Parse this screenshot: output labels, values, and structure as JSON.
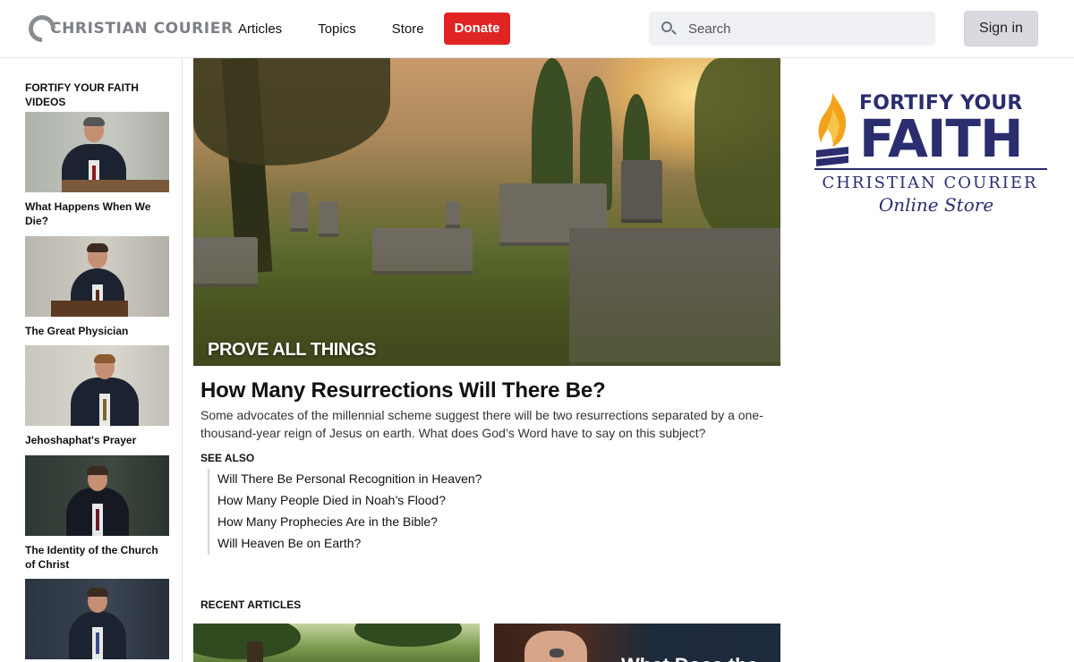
{
  "header": {
    "logo_text": "CHRISTIAN COURIER",
    "nav": [
      "Articles",
      "Topics",
      "Store"
    ],
    "donate_label": "Donate",
    "search_placeholder": "Search",
    "signin_label": "Sign in"
  },
  "sidebar": {
    "title": "FORTIFY YOUR FAITH VIDEOS",
    "videos": [
      {
        "title": "What Happens When We Die?"
      },
      {
        "title": "The Great Physician"
      },
      {
        "title": "Jehoshaphat's Prayer"
      },
      {
        "title": "The Identity of the Church of Christ"
      },
      {
        "title": ""
      }
    ]
  },
  "feature": {
    "category": "PROVE ALL THINGS",
    "title": "How Many Resurrections Will There Be?",
    "description": "Some advocates of the millennial scheme suggest there will be two resurrections separated by a one-thousand-year reign of Jesus on earth. What does God’s Word have to say on this subject?",
    "see_also_label": "SEE ALSO",
    "see_also": [
      "Will There Be Personal Recognition in Heaven?",
      "How Many People Died in Noah’s Flood?",
      "How Many Prophecies Are in the Bible?",
      "Will Heaven Be on Earth?"
    ]
  },
  "recent": {
    "label": "RECENT ARTICLES",
    "card2_text": "What Does the"
  },
  "store_ad": {
    "line1": "FORTIFY YOUR",
    "line2": "FAITH",
    "line3": "CHRISTIAN COURIER",
    "line4": "Online Store"
  },
  "colors": {
    "donate": "#e02424",
    "brand_navy": "#2a2d6e",
    "flame": "#f3a21b"
  }
}
